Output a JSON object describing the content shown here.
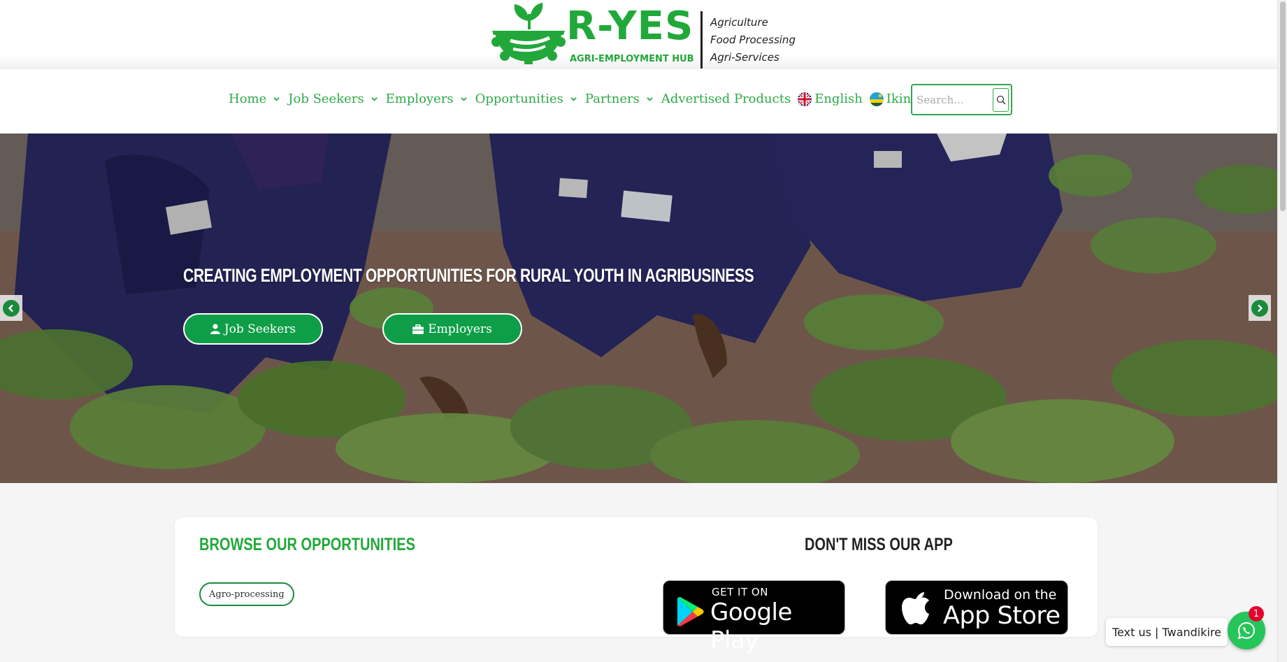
{
  "logo": {
    "name": "R-YES",
    "subtitle": "AGRI-EMPLOYMENT HUB",
    "tagline": [
      "Agriculture",
      "Food Processing",
      "Agri-Services"
    ]
  },
  "nav": {
    "items": [
      {
        "label": "Home",
        "has_dropdown": true
      },
      {
        "label": "Job Seekers",
        "has_dropdown": true
      },
      {
        "label": "Employers",
        "has_dropdown": true
      },
      {
        "label": "Opportunities",
        "has_dropdown": true
      },
      {
        "label": "Partners",
        "has_dropdown": true
      },
      {
        "label": "Advertised Products",
        "has_dropdown": false
      }
    ],
    "languages": [
      {
        "label": "English",
        "flag_icon": "uk-flag-icon"
      },
      {
        "label": "Ikinyarwanda",
        "flag_icon": "rwanda-flag-icon"
      }
    ],
    "search_placeholder": "Search...",
    "search_icon": "search-icon"
  },
  "hero": {
    "headline": "CREATING EMPLOYMENT OPPORTUNITIES FOR RURAL YOUTH IN AGRIBUSINESS",
    "buttons": [
      {
        "label": "Job Seekers",
        "icon": "user-icon"
      },
      {
        "label": "Employers",
        "icon": "briefcase-icon"
      }
    ],
    "prev_icon": "chevron-left-icon",
    "next_icon": "chevron-right-icon"
  },
  "browse": {
    "title": "BROWSE OUR OPPORTUNITIES",
    "tags": [
      "Agro-processing"
    ]
  },
  "app": {
    "title": "DON'T MISS OUR APP",
    "google_play": {
      "top": "GET IT ON",
      "bottom": "Google Play"
    },
    "app_store": {
      "top": "Download on the",
      "bottom": "App Store"
    }
  },
  "chat": {
    "label": "Text us | Twandikire",
    "badge_count": "1",
    "icon": "whatsapp-icon"
  },
  "colors": {
    "brand_green": "#22a83a",
    "nav_green": "#2fa84a",
    "button_green": "#0e9e48",
    "whatsapp_green": "#25c55a",
    "badge_red": "#e4002b"
  }
}
